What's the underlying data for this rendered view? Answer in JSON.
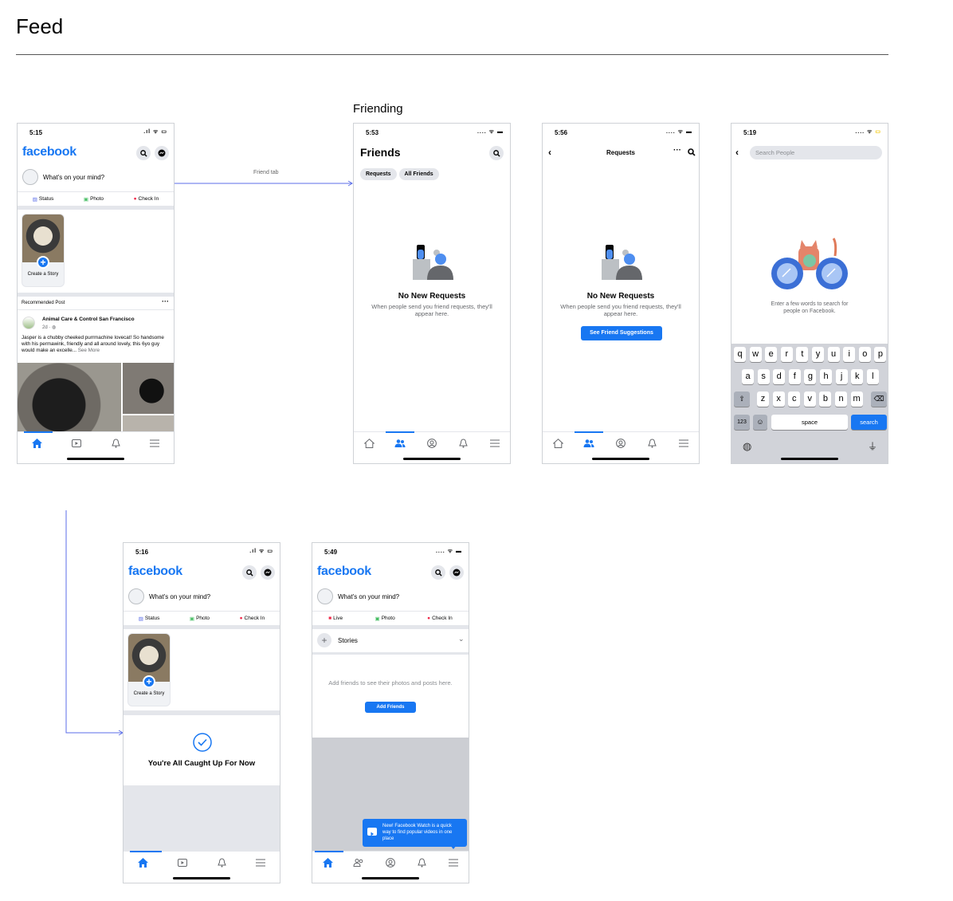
{
  "page": {
    "title": "Feed",
    "section_friending": "Friending",
    "arrow_label": "Friend tab"
  },
  "feed1": {
    "time": "5:15",
    "logo": "facebook",
    "composer": "What's on your mind?",
    "actions": [
      "Status",
      "Photo",
      "Check In"
    ],
    "story_label": "Create a Story",
    "recommended": "Recommended Post",
    "post_author": "Animal Care & Control San Francisco",
    "post_meta": "2d · ",
    "post_text": "Jasper is a chubby cheeked purrmachine lovecat! So handsome with his permawink, friendly and all around lovely, this 6yo guy would make an excelle...",
    "see_more": "See More"
  },
  "friends": {
    "time": "5:53",
    "title": "Friends",
    "pills": [
      "Requests",
      "All Friends"
    ],
    "empty_title": "No New Requests",
    "empty_text": "When people send you friend requests, they'll appear here."
  },
  "requests": {
    "time": "5:56",
    "title": "Requests",
    "empty_title": "No New Requests",
    "empty_text": "When people send you friend requests, they'll appear here.",
    "button": "See Friend Suggestions"
  },
  "search": {
    "time": "5:19",
    "placeholder": "Search People",
    "hint": "Enter a few words to search for people on Facebook.",
    "row1": [
      "q",
      "w",
      "e",
      "r",
      "t",
      "y",
      "u",
      "i",
      "o",
      "p"
    ],
    "row2": [
      "a",
      "s",
      "d",
      "f",
      "g",
      "h",
      "j",
      "k",
      "l"
    ],
    "row3": [
      "z",
      "x",
      "c",
      "v",
      "b",
      "n",
      "m"
    ],
    "key_123": "123",
    "key_space": "space",
    "key_search": "search"
  },
  "feed2": {
    "time": "5:16",
    "logo": "facebook",
    "composer": "What's on your mind?",
    "actions": [
      "Status",
      "Photo",
      "Check In"
    ],
    "story_label": "Create a Story",
    "caught_up": "You're All Caught Up For Now"
  },
  "feed3": {
    "time": "5:49",
    "logo": "facebook",
    "composer": "What's on your mind?",
    "actions": [
      "Live",
      "Photo",
      "Check In"
    ],
    "stories": "Stories",
    "empty_text": "Add friends to see their photos and posts here.",
    "button": "Add Friends",
    "tooltip": "New! Facebook Watch is a quick way to find popular videos in one place"
  },
  "colors": {
    "brand": "#1877f2",
    "arrow": "#5b6ee8"
  }
}
